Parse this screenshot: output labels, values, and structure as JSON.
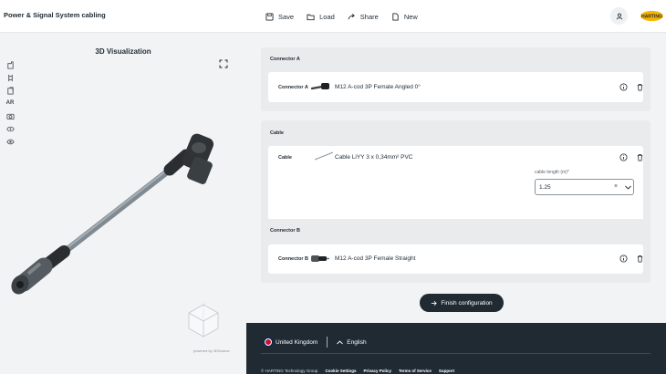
{
  "header": {
    "app_title": "Power & Signal System cabling",
    "toolbar": [
      {
        "label": "Save",
        "icon": "save-icon"
      },
      {
        "label": "Load",
        "icon": "folder-icon"
      },
      {
        "label": "Share",
        "icon": "share-icon"
      },
      {
        "label": "New",
        "icon": "new-file-icon"
      }
    ],
    "user_icon": "user-icon",
    "logo_text": "HARTING",
    "logo_color": "#f7b500"
  },
  "visualization": {
    "title": "3D Visualization",
    "tools": [
      "layers-icon",
      "dimension-icon",
      "building-icon",
      "ar-icon",
      "camera-icon",
      "rotate-icon",
      "eye-icon"
    ],
    "ar_label": "AR",
    "powered_by": "powered by 3DSource"
  },
  "connector_a": {
    "section_title": "Connector A",
    "label": "Connector A",
    "description": "M12 A-cod 3P Female Angled 0°"
  },
  "cable": {
    "section_title": "Cable",
    "label": "Cable",
    "description": "Cable LiYY 3 x 0,34mm² PVC",
    "length_label": "cable length (m)*",
    "length_value": "1.25",
    "clear_symbol": "×"
  },
  "connector_b": {
    "section_title": "Connector B",
    "label": "Connector B",
    "description": "M12 A-cod 3P Female Straight"
  },
  "finish": {
    "label": "Finish configuration"
  },
  "footer": {
    "country": "United Kingdom",
    "language": "English",
    "copyright": "© HARTING Technology Group",
    "links": [
      "Cookie Settings",
      "Privacy Policy",
      "Terms of Service",
      "Support"
    ]
  },
  "colors": {
    "dark": "#1f2a33",
    "panel": "#f2f3f4",
    "section": "#e9ebed",
    "accent": "#f7b500"
  }
}
